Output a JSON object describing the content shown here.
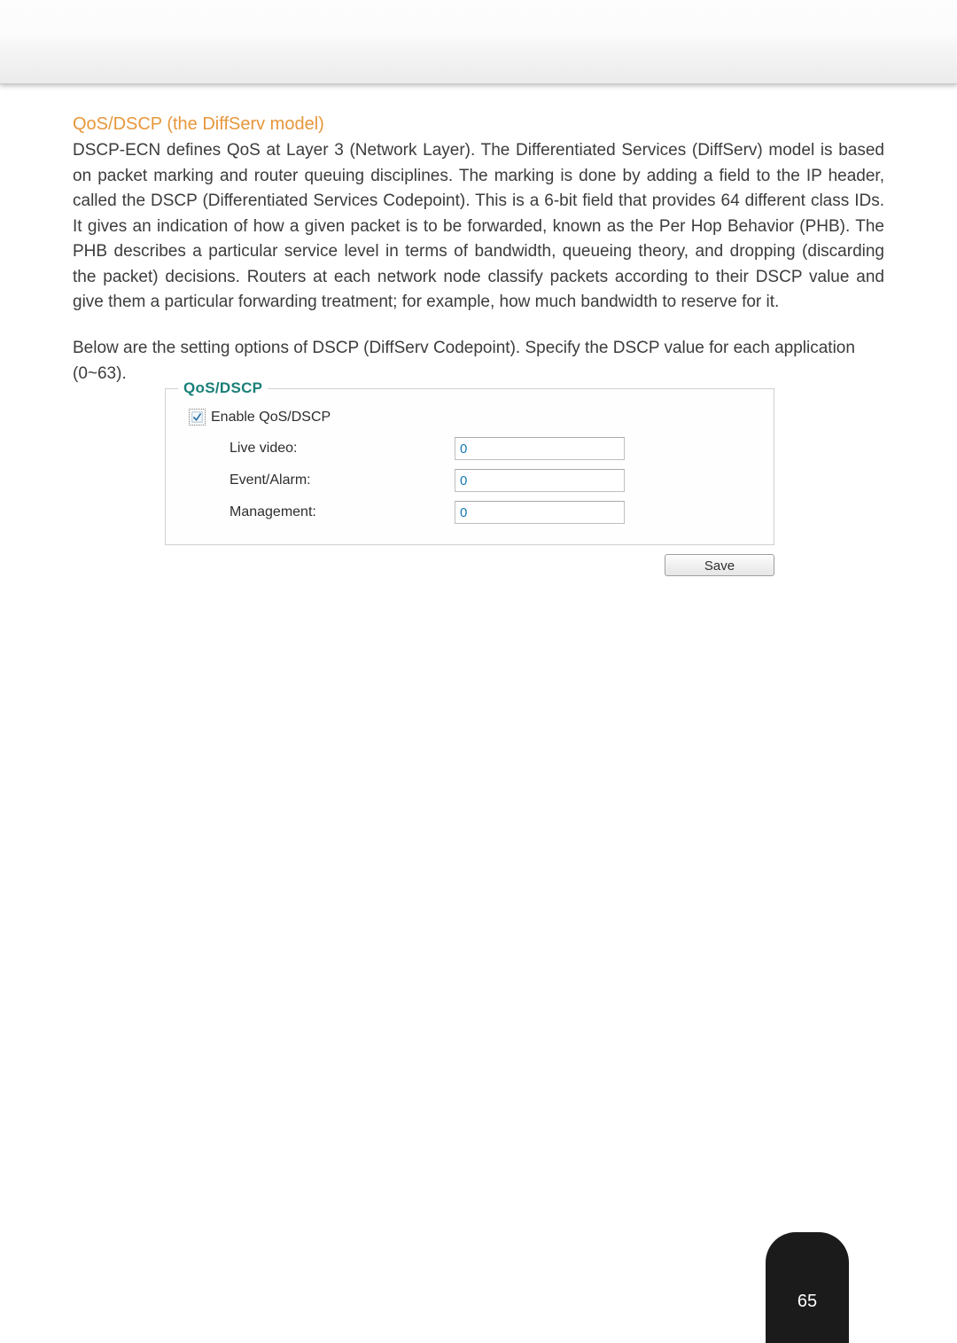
{
  "heading": "QoS/DSCP (the DiffServ model)",
  "paragraph1": "DSCP-ECN defines QoS at Layer 3 (Network Layer). The Differentiated Services (DiffServ) model is based on packet marking and router queuing disciplines. The marking is done by adding a field to the IP header, called the DSCP (Differentiated Services Codepoint). This is a 6-bit field that provides 64 different class IDs. It gives an indication of how a given packet is to be forwarded, known as the Per Hop Behavior (PHB). The PHB describes a particular service level in terms of bandwidth, queueing theory, and dropping (discarding the packet) decisions. Routers at each network node classify packets according to their DSCP value and give them a particular forwarding treatment; for example, how much bandwidth to reserve for it.",
  "paragraph2": "Below are the setting options of DSCP (DiffServ Codepoint). Specify the DSCP value for each application (0~63).",
  "panel": {
    "legend": "QoS/DSCP",
    "enable_label": "Enable QoS/DSCP",
    "rows": {
      "live_video": {
        "label": "Live video:",
        "value": "0"
      },
      "event_alarm": {
        "label": "Event/Alarm:",
        "value": "0"
      },
      "management": {
        "label": "Management:",
        "value": "0"
      }
    }
  },
  "save_label": "Save",
  "page_number": "65"
}
